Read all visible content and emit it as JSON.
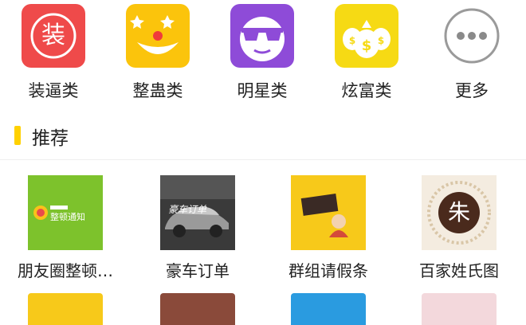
{
  "categories": [
    {
      "label": "装逼类",
      "icon": "zhuang-badge-icon",
      "color": "#ef4a4a",
      "glyph": "装"
    },
    {
      "label": "整蛊类",
      "icon": "clown-face-icon",
      "color": "#fbc40c"
    },
    {
      "label": "明星类",
      "icon": "sunglasses-face-icon",
      "color": "#8e4bd8"
    },
    {
      "label": "炫富类",
      "icon": "money-bags-icon",
      "color": "#f6da14"
    },
    {
      "label": "更多",
      "icon": "more-dots-icon",
      "color": "#999999"
    }
  ],
  "section": {
    "title": "推荐"
  },
  "recommended": [
    {
      "label": "朋友圈整顿…",
      "thumb": "moments-notice-thumb",
      "thumb_text": "整顿通知"
    },
    {
      "label": "豪车订单",
      "thumb": "luxury-car-thumb",
      "thumb_text": "豪车订单"
    },
    {
      "label": "群组请假条",
      "thumb": "leave-note-thumb"
    },
    {
      "label": "百家姓氏图",
      "thumb": "surname-seal-thumb",
      "thumb_text": "朱"
    }
  ]
}
